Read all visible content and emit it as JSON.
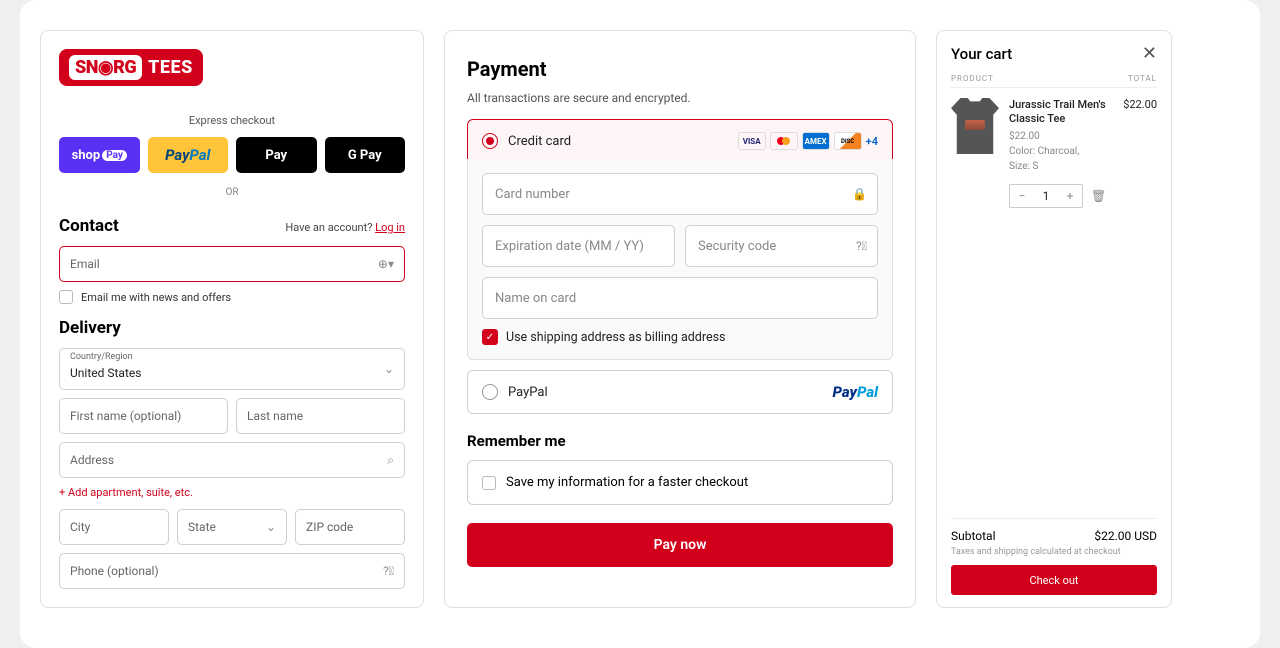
{
  "logo": {
    "part1": "SN",
    "owl": "◉",
    "part2": "RG",
    "tees": "TEES"
  },
  "express": {
    "label": "Express checkout",
    "shoppay": "shop",
    "shoppay_badge": "Pay",
    "paypal_p": "Pay",
    "paypal_pal": "Pal",
    "apple": "Pay",
    "google": "G Pay",
    "or": "OR"
  },
  "contact": {
    "heading": "Contact",
    "have_account": "Have an account? ",
    "login": "Log in",
    "email_placeholder": "Email",
    "news_label": "Email me with news and offers"
  },
  "delivery": {
    "heading": "Delivery",
    "country_label": "Country/Region",
    "country_value": "United States",
    "first_name": "First name (optional)",
    "last_name": "Last name",
    "address": "Address",
    "add_apt": "+ Add apartment, suite, etc.",
    "city": "City",
    "state": "State",
    "zip": "ZIP code",
    "phone": "Phone (optional)"
  },
  "payment": {
    "heading": "Payment",
    "secure": "All transactions are secure and encrypted.",
    "credit_card": "Credit card",
    "plus4": "+4",
    "card_number": "Card number",
    "expiry": "Expiration date (MM / YY)",
    "cvv": "Security code",
    "name_on_card": "Name on card",
    "use_shipping": "Use shipping address as billing address",
    "paypal": "PayPal",
    "remember_heading": "Remember me",
    "remember_label": "Save my information for a faster checkout",
    "pay_now": "Pay now"
  },
  "cart": {
    "heading": "Your cart",
    "col_product": "PRODUCT",
    "col_total": "TOTAL",
    "item": {
      "title": "Jurassic Trail Men's Classic Tee",
      "price": "$22.00",
      "unit_price": "$22.00",
      "color": "Color: Charcoal,",
      "size": "Size: S",
      "qty": "1"
    },
    "subtotal_label": "Subtotal",
    "subtotal_value": "$22.00 USD",
    "tax_note": "Taxes and shipping calculated at checkout",
    "checkout": "Check out"
  }
}
